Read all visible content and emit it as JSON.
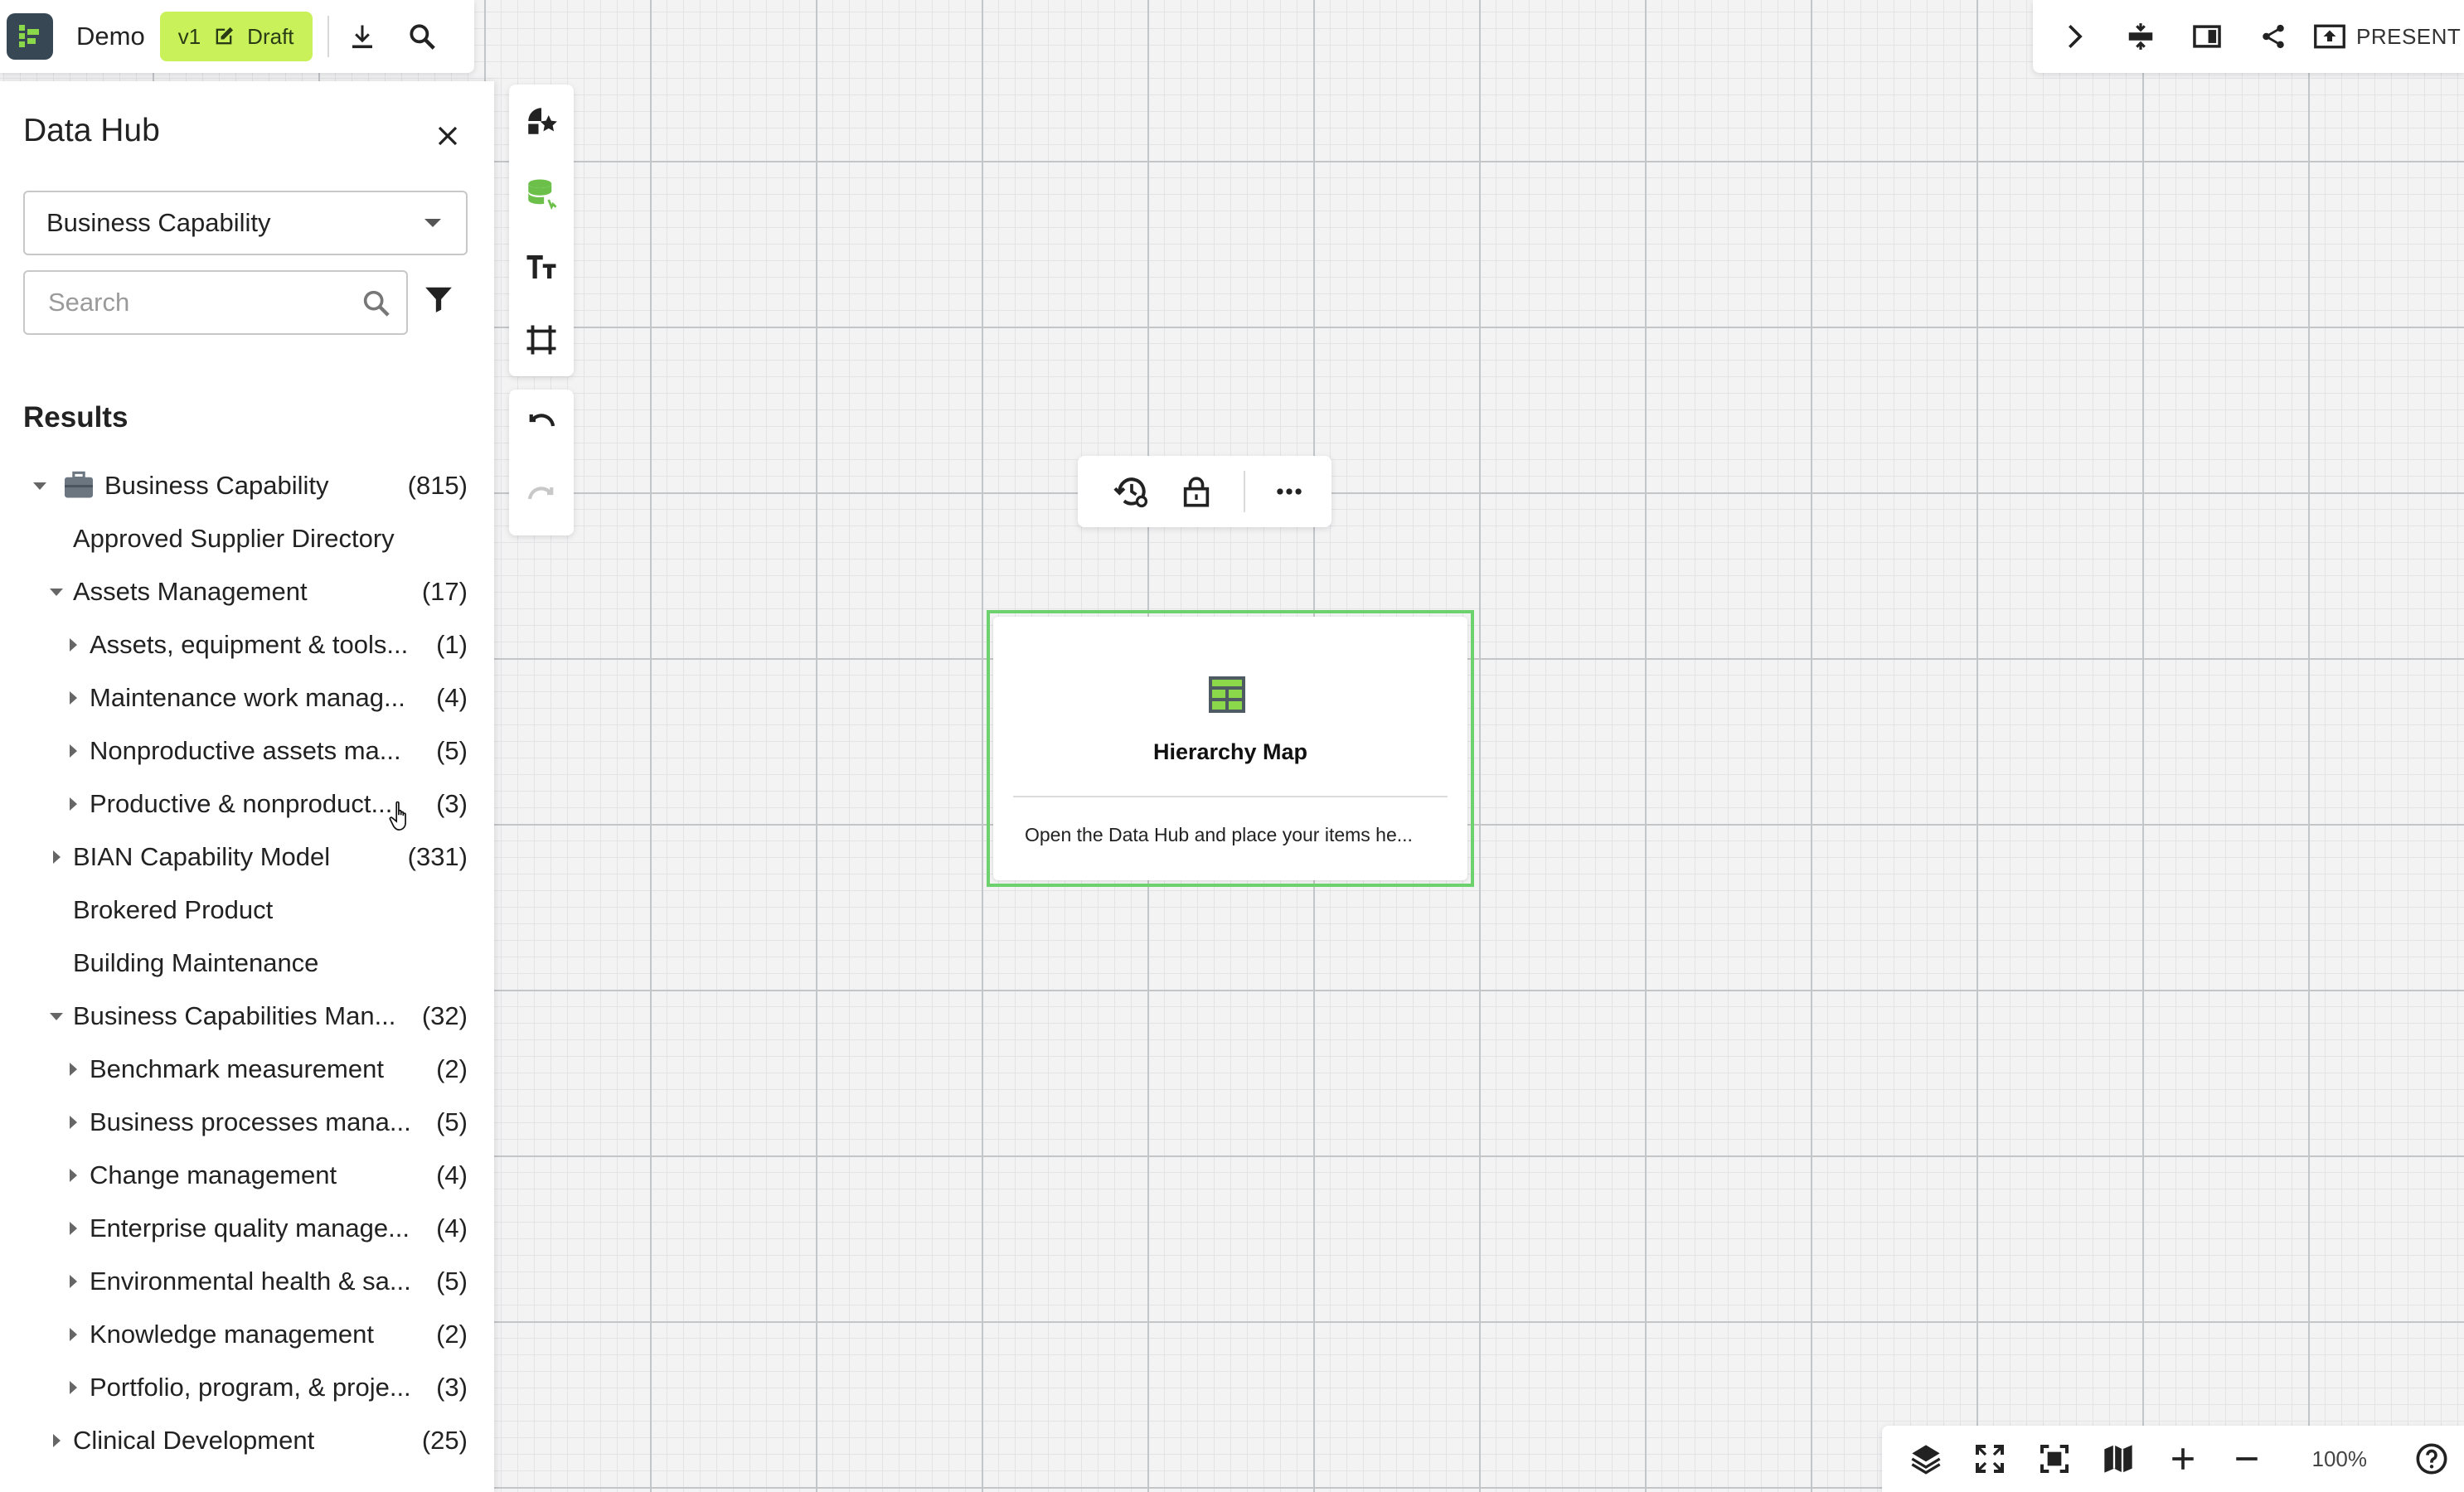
{
  "header": {
    "doc_title": "Demo",
    "version": "v1",
    "draft_label": "Draft"
  },
  "top_right": {
    "present_label": "PRESENT"
  },
  "data_hub": {
    "title": "Data Hub",
    "selected_type": "Business Capability",
    "search_placeholder": "Search",
    "results_heading": "Results",
    "tree": [
      {
        "label": "Business Capability",
        "count": "(815)",
        "level": 0,
        "caret": "down",
        "icon": "briefcase-icon"
      },
      {
        "label": "Approved Supplier Directory",
        "count": "",
        "level": 1,
        "caret": "none"
      },
      {
        "label": "Assets Management",
        "count": "(17)",
        "level": 1,
        "caret": "down"
      },
      {
        "label": "Assets, equipment & tools...",
        "count": "(1)",
        "level": 2,
        "caret": "right"
      },
      {
        "label": "Maintenance work manag...",
        "count": "(4)",
        "level": 2,
        "caret": "right"
      },
      {
        "label": "Nonproductive assets ma...",
        "count": "(5)",
        "level": 2,
        "caret": "right"
      },
      {
        "label": "Productive & nonproduct...",
        "count": "(3)",
        "level": 2,
        "caret": "right"
      },
      {
        "label": "BIAN Capability Model",
        "count": "(331)",
        "level": 1,
        "caret": "right"
      },
      {
        "label": "Brokered Product",
        "count": "",
        "level": 1,
        "caret": "none"
      },
      {
        "label": "Building Maintenance",
        "count": "",
        "level": 1,
        "caret": "none"
      },
      {
        "label": "Business Capabilities Man...",
        "count": "(32)",
        "level": 1,
        "caret": "down"
      },
      {
        "label": "Benchmark measurement",
        "count": "(2)",
        "level": 2,
        "caret": "right"
      },
      {
        "label": "Business processes mana...",
        "count": "(5)",
        "level": 2,
        "caret": "right"
      },
      {
        "label": "Change management",
        "count": "(4)",
        "level": 2,
        "caret": "right"
      },
      {
        "label": "Enterprise quality manage...",
        "count": "(4)",
        "level": 2,
        "caret": "right"
      },
      {
        "label": "Environmental health & sa...",
        "count": "(5)",
        "level": 2,
        "caret": "right"
      },
      {
        "label": "Knowledge management",
        "count": "(2)",
        "level": 2,
        "caret": "right"
      },
      {
        "label": "Portfolio, program, & proje...",
        "count": "(3)",
        "level": 2,
        "caret": "right"
      },
      {
        "label": "Clinical Development",
        "count": "(25)",
        "level": 1,
        "caret": "right"
      }
    ]
  },
  "canvas_card": {
    "title": "Hierarchy Map",
    "description": "Open the Data Hub and place your items he..."
  },
  "bottom_bar": {
    "zoom_level": "100%"
  },
  "colors": {
    "draft_badge": "#c9f25a",
    "selection_border": "#6dd16d",
    "logo_bg": "#374754",
    "logo_accent": "#8bd94a"
  }
}
